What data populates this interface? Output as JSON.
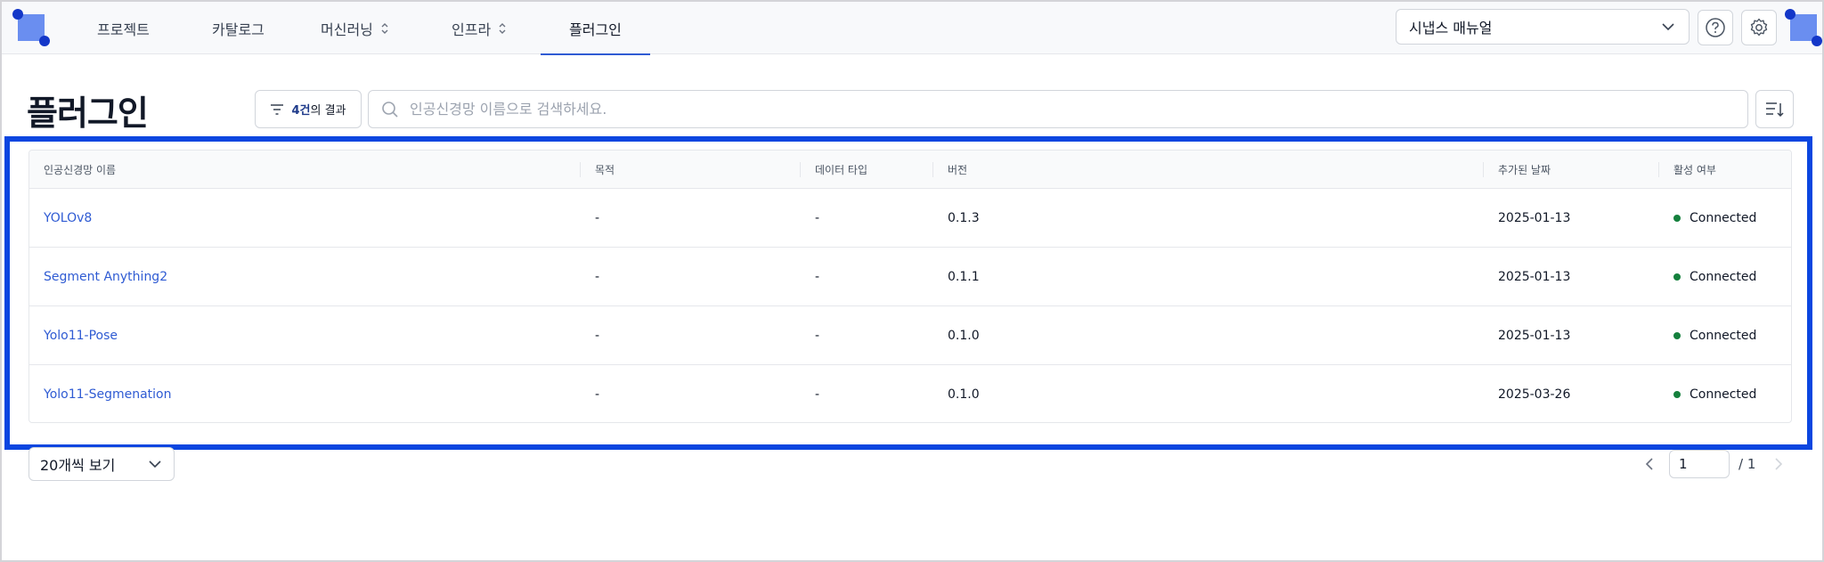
{
  "header": {
    "nav": [
      {
        "label": "프로젝트",
        "has_chevron": false,
        "active": false
      },
      {
        "label": "카탈로그",
        "has_chevron": false,
        "active": false
      },
      {
        "label": "머신러닝",
        "has_chevron": true,
        "active": false
      },
      {
        "label": "인프라",
        "has_chevron": true,
        "active": false
      },
      {
        "label": "플러그인",
        "has_chevron": false,
        "active": true
      }
    ],
    "manual_select": "시냅스 매뉴얼",
    "icons": [
      "help-icon",
      "settings-icon"
    ]
  },
  "page": {
    "title": "플러그인",
    "result_count": "4건",
    "result_suffix": "의 결과",
    "search_placeholder": "인공신경망 이름으로 검색하세요."
  },
  "table": {
    "columns": [
      "인공신경망 이름",
      "목적",
      "데이터 타입",
      "버전",
      "추가된 날짜",
      "활성 여부"
    ],
    "rows": [
      {
        "name": "YOLOv8",
        "purpose": "-",
        "data_type": "-",
        "version": "0.1.3",
        "date": "2025-01-13",
        "status": "Connected"
      },
      {
        "name": "Segment Anything2",
        "purpose": "-",
        "data_type": "-",
        "version": "0.1.1",
        "date": "2025-01-13",
        "status": "Connected"
      },
      {
        "name": "Yolo11-Pose",
        "purpose": "-",
        "data_type": "-",
        "version": "0.1.0",
        "date": "2025-01-13",
        "status": "Connected"
      },
      {
        "name": "Yolo11-Segmenation",
        "purpose": "-",
        "data_type": "-",
        "version": "0.1.0",
        "date": "2025-03-26",
        "status": "Connected"
      }
    ],
    "status_color": "#15803d",
    "link_color": "#2f5bd3"
  },
  "footer": {
    "page_size": "20개씩 보기",
    "current_page": "1",
    "total_pages": "/ 1"
  },
  "colors": {
    "accent": "#2f5bd3",
    "highlight": "#0b46e0",
    "logo": "#6a8ef0"
  }
}
